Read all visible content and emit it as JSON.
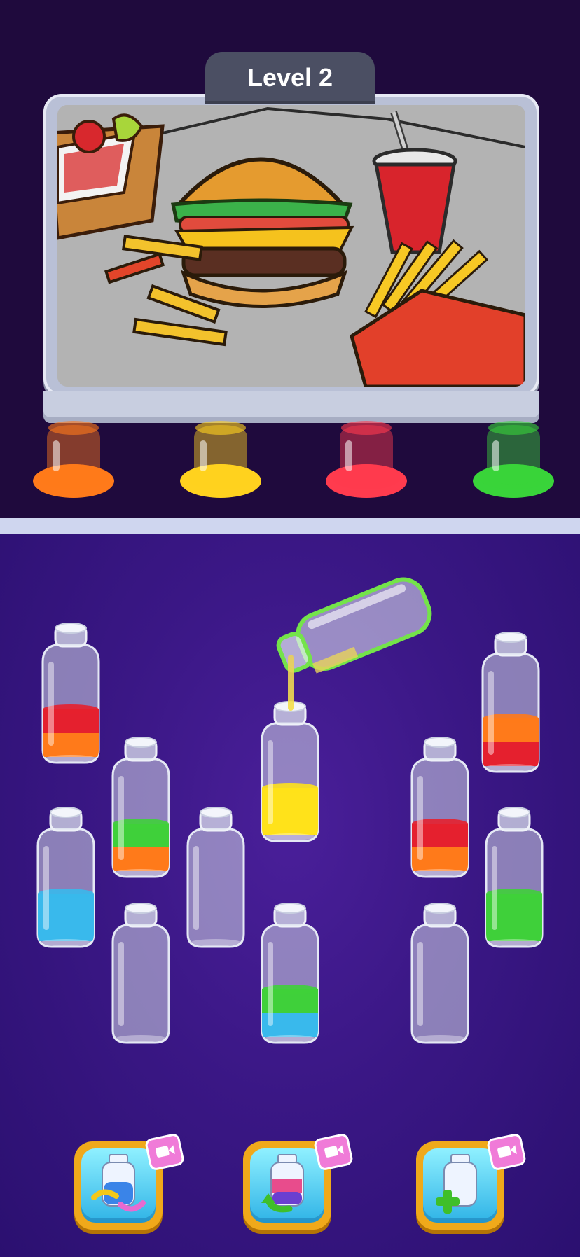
{
  "header": {
    "level_label": "Level 2"
  },
  "picture": {
    "subject_icon": "burger-picnic-picture"
  },
  "color_jars": [
    {
      "color": "orange",
      "hex": "#ff7a1a"
    },
    {
      "color": "yellow",
      "hex": "#ffd21f"
    },
    {
      "color": "red",
      "hex": "#ff3b4e"
    },
    {
      "color": "green",
      "hex": "#39d43a"
    }
  ],
  "bottles": [
    {
      "id": "bottle-1",
      "layers_bottom_to_top": [
        "orange",
        "red"
      ]
    },
    {
      "id": "bottle-2",
      "layers_bottom_to_top": [
        "orange",
        "green"
      ]
    },
    {
      "id": "bottle-3",
      "layers_bottom_to_top": [
        "blue"
      ]
    },
    {
      "id": "bottle-4",
      "layers_bottom_to_top": []
    },
    {
      "id": "bottle-5",
      "layers_bottom_to_top": []
    },
    {
      "id": "bottle-6",
      "layers_bottom_to_top": [
        "yellow"
      ]
    },
    {
      "id": "bottle-7",
      "layers_bottom_to_top": [
        "blue",
        "green"
      ]
    },
    {
      "id": "bottle-8",
      "layers_bottom_to_top": [
        "orange",
        "red"
      ]
    },
    {
      "id": "bottle-9",
      "layers_bottom_to_top": []
    },
    {
      "id": "bottle-10",
      "layers_bottom_to_top": [
        "red",
        "orange"
      ]
    },
    {
      "id": "bottle-11",
      "layers_bottom_to_top": [
        "green"
      ]
    },
    {
      "id": "pouring-bottle",
      "layers_bottom_to_top": [
        "yellow"
      ],
      "selected": true
    }
  ],
  "boosters": [
    {
      "name": "shuffle",
      "icon": "shuffle-bottle-icon",
      "badge_icon": "video-ad-icon"
    },
    {
      "name": "undo",
      "icon": "undo-bottle-icon",
      "badge_icon": "video-ad-icon"
    },
    {
      "name": "add-bottle",
      "icon": "add-bottle-icon",
      "badge_icon": "video-ad-icon"
    }
  ],
  "colors": {
    "orange": "#ff7a1a",
    "yellow": "#ffe21a",
    "red": "#e5202e",
    "green": "#3fd03a",
    "blue": "#39b9ec",
    "selected_outline": "#74e34a"
  }
}
